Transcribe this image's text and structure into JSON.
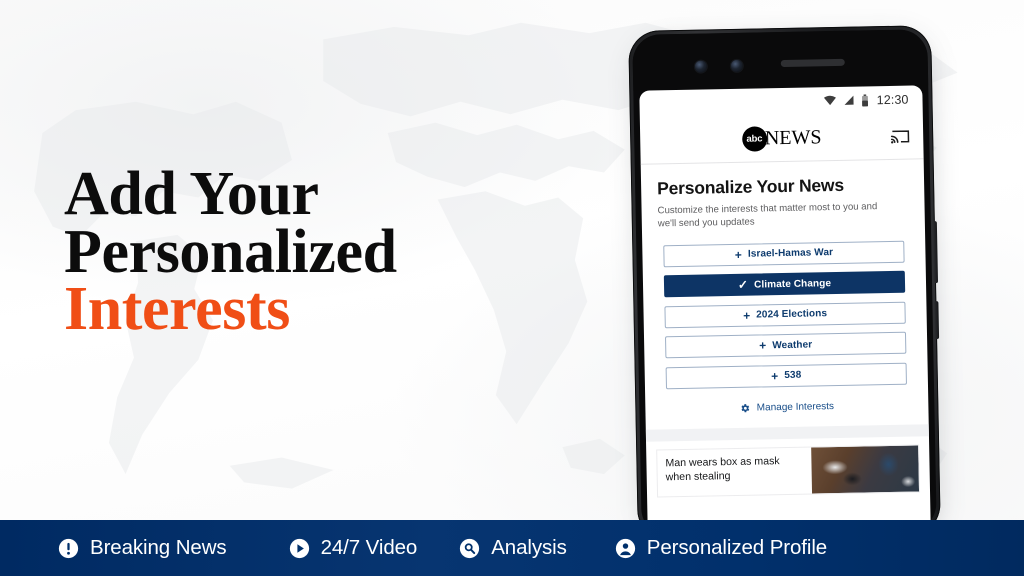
{
  "headline": {
    "line1": "Add Your",
    "line2": "Personalized",
    "line3": "Interests",
    "accent_color": "#f04e16",
    "text_color": "#0c0c0c"
  },
  "phone": {
    "status_bar": {
      "time": "12:30",
      "icons": [
        "wifi-icon",
        "cellular-signal-icon",
        "battery-icon"
      ]
    },
    "app_header": {
      "logo_mark": "abc",
      "logo_word": "NEWS",
      "cast_icon": "cast-icon"
    },
    "screen": {
      "section_title": "Personalize Your News",
      "section_subtitle": "Customize the interests that matter most to you and we'll send you updates",
      "interests": [
        {
          "label": "Israel-Hamas War",
          "glyph": "+",
          "selected": false
        },
        {
          "label": "Climate Change",
          "glyph": "✓",
          "selected": true
        },
        {
          "label": "2024 Elections",
          "glyph": "+",
          "selected": false
        },
        {
          "label": "Weather",
          "glyph": "+",
          "selected": false
        },
        {
          "label": "538",
          "glyph": "+",
          "selected": false
        }
      ],
      "manage_label": "Manage Interests",
      "manage_icon": "gear-icon",
      "news_card": {
        "headline": "Man wears box as mask when stealing"
      }
    },
    "selected_chip_color": "#0d3465",
    "chip_text_color": "#0d3b6e"
  },
  "bottom_bar": {
    "background_color": "#00306b",
    "items": [
      {
        "label": "Breaking News",
        "icon": "exclamation-circle-icon"
      },
      {
        "label": "24/7 Video",
        "icon": "play-circle-icon"
      },
      {
        "label": "Analysis",
        "icon": "magnifier-circle-icon"
      },
      {
        "label": "Personalized Profile",
        "icon": "person-circle-icon"
      }
    ]
  }
}
